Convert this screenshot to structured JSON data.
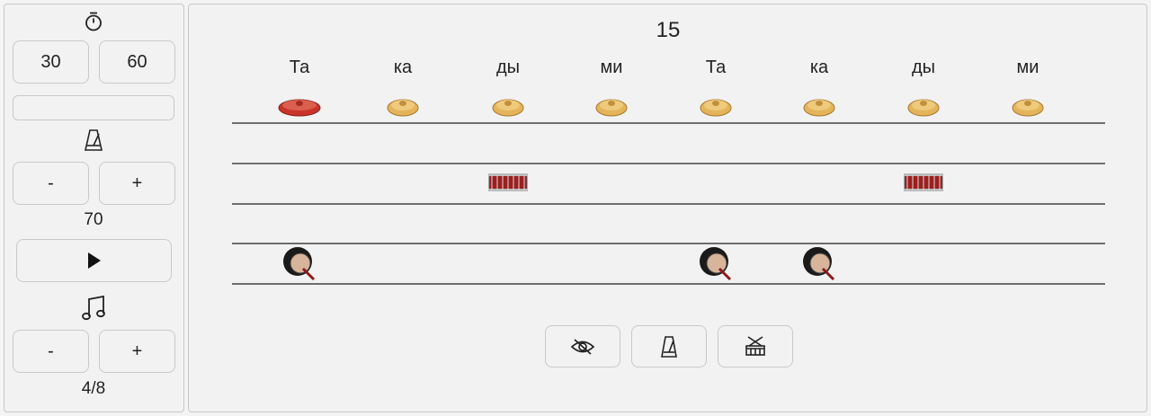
{
  "sidebar": {
    "timer_icon": "stopwatch-icon",
    "time_options": [
      "30",
      "60"
    ],
    "progress": 0,
    "metronome_icon": "metronome-icon",
    "tempo_minus": "-",
    "tempo_plus": "+",
    "tempo_value": "70",
    "play_icon": "play-icon",
    "meter_icon": "music-note-icon",
    "meter_minus": "-",
    "meter_plus": "+",
    "meter_value": "4/8"
  },
  "main": {
    "counter": "15",
    "syllables": [
      "Та",
      "ка",
      "ды",
      "ми",
      "Та",
      "ка",
      "ды",
      "ми"
    ],
    "rows": {
      "cymbal": [
        "crash",
        "ride",
        "ride",
        "ride",
        "ride",
        "ride",
        "ride",
        "ride"
      ],
      "snare": [
        0,
        0,
        1,
        0,
        0,
        0,
        1,
        0
      ],
      "kick": [
        1,
        0,
        0,
        0,
        1,
        1,
        0,
        0
      ]
    },
    "bottom_icons": [
      "eye-off-icon",
      "metronome-icon",
      "drum-icon"
    ]
  },
  "colors": {
    "background": "#f2f2f2",
    "crash": "#c8342b",
    "ride": "#e3b45a",
    "snare": "#9c1f1f"
  }
}
